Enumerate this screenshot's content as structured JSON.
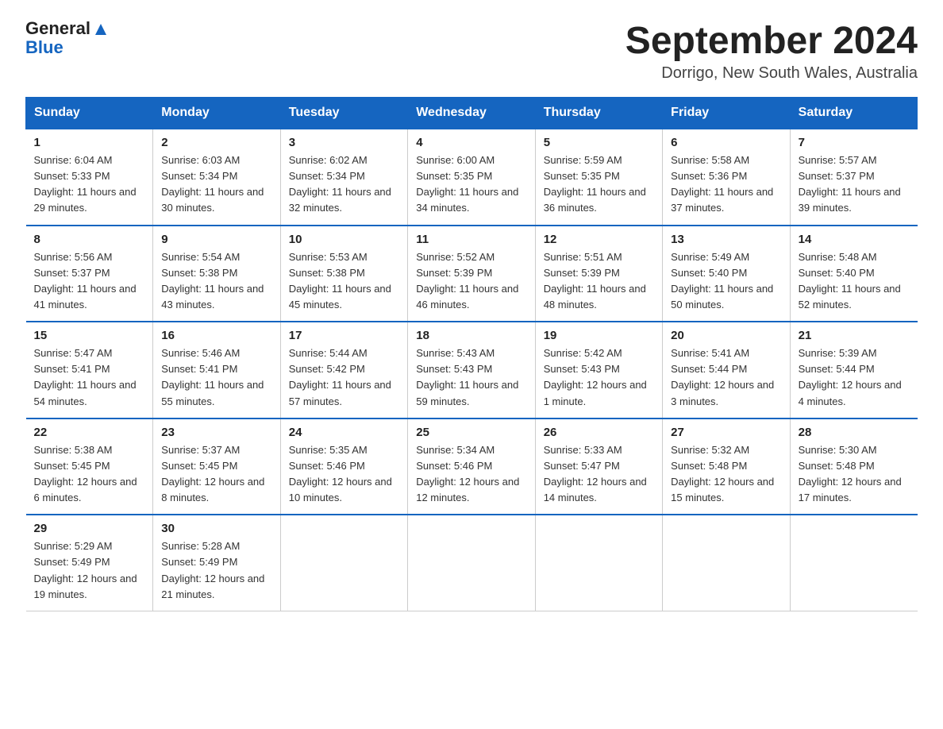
{
  "logo": {
    "line1": "General",
    "triangle": "▲",
    "line2": "Blue"
  },
  "title": "September 2024",
  "subtitle": "Dorrigo, New South Wales, Australia",
  "days_of_week": [
    "Sunday",
    "Monday",
    "Tuesday",
    "Wednesday",
    "Thursday",
    "Friday",
    "Saturday"
  ],
  "weeks": [
    [
      {
        "day": "1",
        "sunrise": "6:04 AM",
        "sunset": "5:33 PM",
        "daylight": "11 hours and 29 minutes."
      },
      {
        "day": "2",
        "sunrise": "6:03 AM",
        "sunset": "5:34 PM",
        "daylight": "11 hours and 30 minutes."
      },
      {
        "day": "3",
        "sunrise": "6:02 AM",
        "sunset": "5:34 PM",
        "daylight": "11 hours and 32 minutes."
      },
      {
        "day": "4",
        "sunrise": "6:00 AM",
        "sunset": "5:35 PM",
        "daylight": "11 hours and 34 minutes."
      },
      {
        "day": "5",
        "sunrise": "5:59 AM",
        "sunset": "5:35 PM",
        "daylight": "11 hours and 36 minutes."
      },
      {
        "day": "6",
        "sunrise": "5:58 AM",
        "sunset": "5:36 PM",
        "daylight": "11 hours and 37 minutes."
      },
      {
        "day": "7",
        "sunrise": "5:57 AM",
        "sunset": "5:37 PM",
        "daylight": "11 hours and 39 minutes."
      }
    ],
    [
      {
        "day": "8",
        "sunrise": "5:56 AM",
        "sunset": "5:37 PM",
        "daylight": "11 hours and 41 minutes."
      },
      {
        "day": "9",
        "sunrise": "5:54 AM",
        "sunset": "5:38 PM",
        "daylight": "11 hours and 43 minutes."
      },
      {
        "day": "10",
        "sunrise": "5:53 AM",
        "sunset": "5:38 PM",
        "daylight": "11 hours and 45 minutes."
      },
      {
        "day": "11",
        "sunrise": "5:52 AM",
        "sunset": "5:39 PM",
        "daylight": "11 hours and 46 minutes."
      },
      {
        "day": "12",
        "sunrise": "5:51 AM",
        "sunset": "5:39 PM",
        "daylight": "11 hours and 48 minutes."
      },
      {
        "day": "13",
        "sunrise": "5:49 AM",
        "sunset": "5:40 PM",
        "daylight": "11 hours and 50 minutes."
      },
      {
        "day": "14",
        "sunrise": "5:48 AM",
        "sunset": "5:40 PM",
        "daylight": "11 hours and 52 minutes."
      }
    ],
    [
      {
        "day": "15",
        "sunrise": "5:47 AM",
        "sunset": "5:41 PM",
        "daylight": "11 hours and 54 minutes."
      },
      {
        "day": "16",
        "sunrise": "5:46 AM",
        "sunset": "5:41 PM",
        "daylight": "11 hours and 55 minutes."
      },
      {
        "day": "17",
        "sunrise": "5:44 AM",
        "sunset": "5:42 PM",
        "daylight": "11 hours and 57 minutes."
      },
      {
        "day": "18",
        "sunrise": "5:43 AM",
        "sunset": "5:43 PM",
        "daylight": "11 hours and 59 minutes."
      },
      {
        "day": "19",
        "sunrise": "5:42 AM",
        "sunset": "5:43 PM",
        "daylight": "12 hours and 1 minute."
      },
      {
        "day": "20",
        "sunrise": "5:41 AM",
        "sunset": "5:44 PM",
        "daylight": "12 hours and 3 minutes."
      },
      {
        "day": "21",
        "sunrise": "5:39 AM",
        "sunset": "5:44 PM",
        "daylight": "12 hours and 4 minutes."
      }
    ],
    [
      {
        "day": "22",
        "sunrise": "5:38 AM",
        "sunset": "5:45 PM",
        "daylight": "12 hours and 6 minutes."
      },
      {
        "day": "23",
        "sunrise": "5:37 AM",
        "sunset": "5:45 PM",
        "daylight": "12 hours and 8 minutes."
      },
      {
        "day": "24",
        "sunrise": "5:35 AM",
        "sunset": "5:46 PM",
        "daylight": "12 hours and 10 minutes."
      },
      {
        "day": "25",
        "sunrise": "5:34 AM",
        "sunset": "5:46 PM",
        "daylight": "12 hours and 12 minutes."
      },
      {
        "day": "26",
        "sunrise": "5:33 AM",
        "sunset": "5:47 PM",
        "daylight": "12 hours and 14 minutes."
      },
      {
        "day": "27",
        "sunrise": "5:32 AM",
        "sunset": "5:48 PM",
        "daylight": "12 hours and 15 minutes."
      },
      {
        "day": "28",
        "sunrise": "5:30 AM",
        "sunset": "5:48 PM",
        "daylight": "12 hours and 17 minutes."
      }
    ],
    [
      {
        "day": "29",
        "sunrise": "5:29 AM",
        "sunset": "5:49 PM",
        "daylight": "12 hours and 19 minutes."
      },
      {
        "day": "30",
        "sunrise": "5:28 AM",
        "sunset": "5:49 PM",
        "daylight": "12 hours and 21 minutes."
      },
      null,
      null,
      null,
      null,
      null
    ]
  ],
  "accent_color": "#1565c0"
}
